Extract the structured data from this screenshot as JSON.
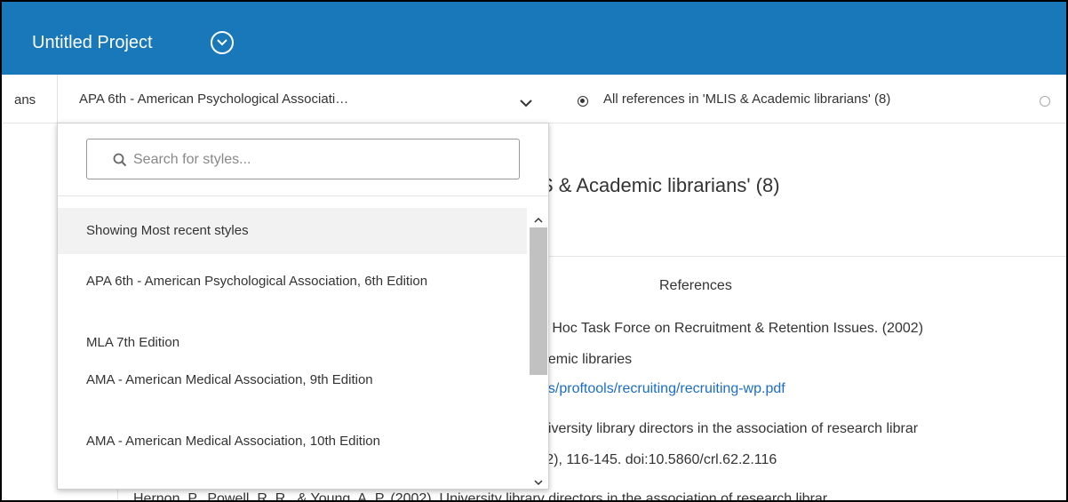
{
  "app": {
    "project_title": "Untitled Project",
    "project_menu_icon": "chevron-down-circle-icon"
  },
  "toolbar": {
    "truncated_tab_label": "ans",
    "style_selected": "APA 6th - American Psychological Associati…",
    "style_dropdown_icon": "chevron-down-icon",
    "reference_scope": {
      "all_label": "All references in 'MLIS & Academic librarians' (8)",
      "all_selected": true,
      "other_selected": false
    }
  },
  "style_dropdown": {
    "search_placeholder": "Search for styles...",
    "search_value": "",
    "search_icon": "search-icon",
    "section_label": "Showing Most recent styles",
    "items": [
      {
        "label": "APA 6th - American Psychological Association, 6th Edition"
      },
      {
        "label": "MLA 7th Edition"
      },
      {
        "label": "AMA - American Medical Association, 9th Edition"
      },
      {
        "label": "AMA - American Medical Association, 10th Edition"
      }
    ]
  },
  "content": {
    "heading_visible": "S & Academic librarians' (8)",
    "references_heading": "References",
    "ref_lines": [
      "d Hoc Task Force on Recruitment & Retention Issues. (2002)",
      "demic libraries",
      "es/proftools/recruiting/recruiting-wp.pdf",
      "niversity library directors in the association of research librar",
      "2(2), 116-145. doi:10.5860/crl.62.2.116",
      "Hernon, P., Powell, R. R., & Young, A. P. (2002). University library directors in the association of research librar"
    ],
    "link_color": "#1a6dc6"
  },
  "colors": {
    "header_bg": "#1878b9",
    "accent_link": "#1a6dc6"
  }
}
